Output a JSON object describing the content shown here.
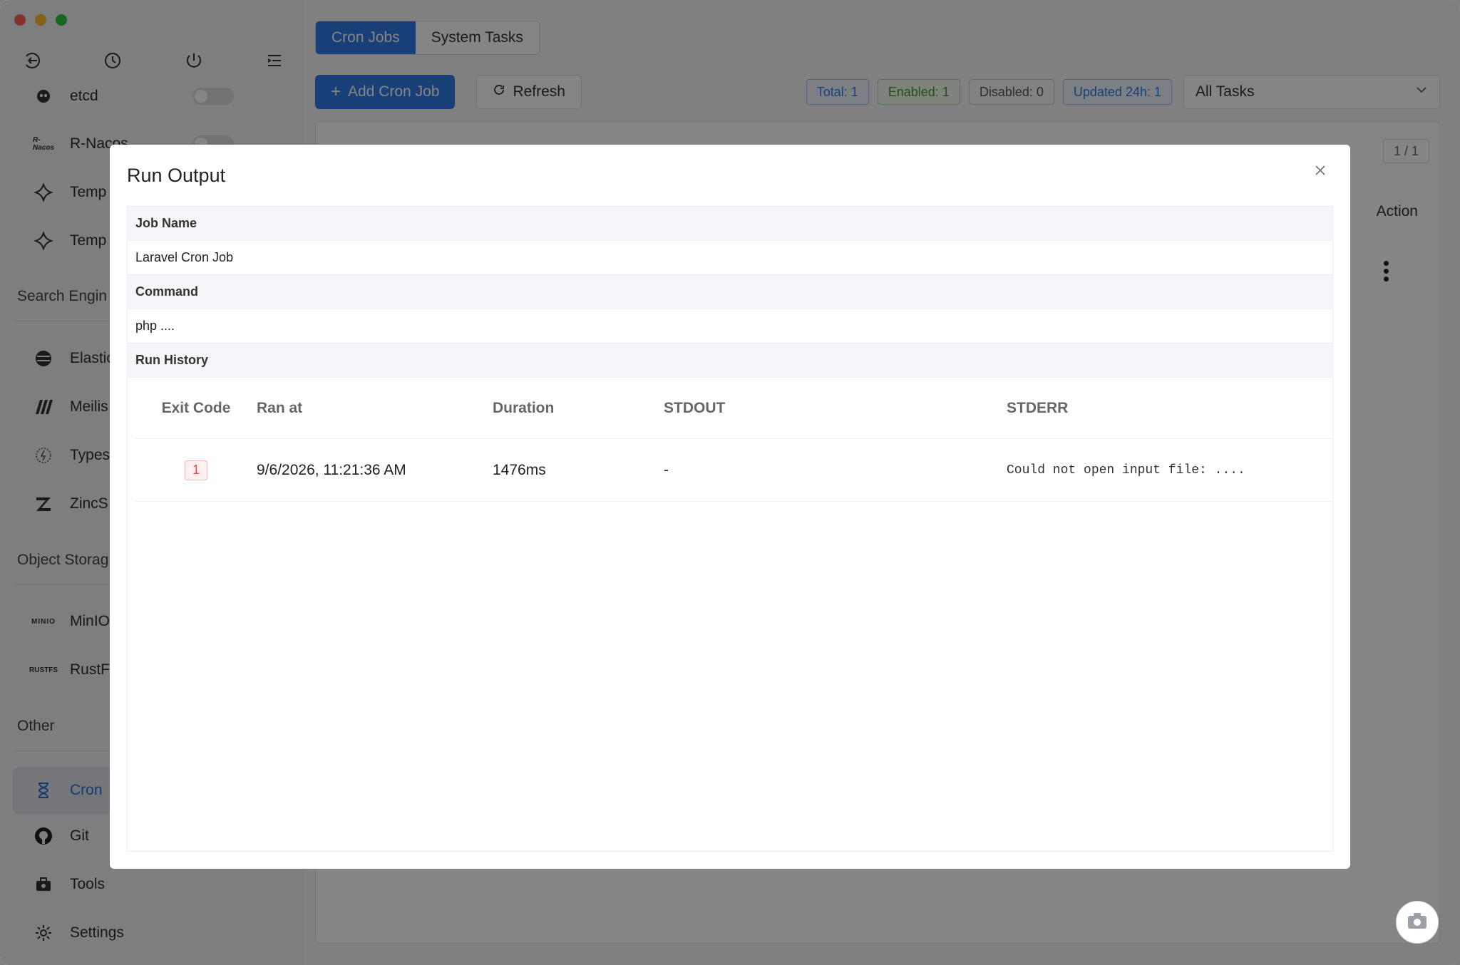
{
  "sidebar": {
    "items_top": [
      {
        "label": "etcd",
        "icon": "etcd-icon",
        "toggle": true
      },
      {
        "label": "R-Nacos",
        "icon": "r-nacos-icon",
        "toggle": true,
        "icon_text": "R-Nacos"
      },
      {
        "label": "Temp",
        "icon": "temporal-icon"
      },
      {
        "label": "Temp",
        "icon": "temporal-icon"
      }
    ],
    "section_search": "Search Engin",
    "items_search": [
      {
        "label": "Elastic",
        "icon": "elasticsearch-icon"
      },
      {
        "label": "Meilis",
        "icon": "meilisearch-icon"
      },
      {
        "label": "Types",
        "icon": "typesense-icon"
      },
      {
        "label": "ZincS",
        "icon": "zincsearch-icon"
      }
    ],
    "section_storage": "Object Storag",
    "items_storage": [
      {
        "label": "MinIO",
        "icon": "minio-icon",
        "icon_text": "MINIO"
      },
      {
        "label": "RustF",
        "icon": "rustfs-icon",
        "icon_text": "RUSTFS"
      }
    ],
    "section_other": "Other",
    "items_other": [
      {
        "label": "Cron",
        "icon": "hourglass-icon",
        "active": true
      },
      {
        "label": "Git",
        "icon": "github-icon"
      },
      {
        "label": "Tools",
        "icon": "toolbox-icon"
      },
      {
        "label": "Settings",
        "icon": "gear-icon"
      }
    ]
  },
  "main": {
    "tabs": [
      {
        "label": "Cron Jobs",
        "active": true
      },
      {
        "label": "System Tasks",
        "active": false
      }
    ],
    "add_button": "Add Cron Job",
    "refresh_button": "Refresh",
    "stats": {
      "total": "Total: 1",
      "enabled": "Enabled: 1",
      "disabled": "Disabled: 0",
      "updated": "Updated 24h: 1"
    },
    "filter_select": "All Tasks",
    "pager": "1 / 1",
    "col_action": "Action"
  },
  "modal": {
    "title": "Run Output",
    "job_name_label": "Job Name",
    "job_name_value": "Laravel Cron Job",
    "command_label": "Command",
    "command_value": "php ....",
    "history_label": "Run History",
    "history_columns": [
      "Exit Code",
      "Ran at",
      "Duration",
      "STDOUT",
      "STDERR"
    ],
    "history_rows": [
      {
        "exit_code": "1",
        "ran_at": "9/6/2026, 11:21:36 AM",
        "duration": "1476ms",
        "stdout": "-",
        "stderr": "Could not open input file: ...."
      }
    ]
  },
  "colors": {
    "accent": "#2f7ae5",
    "error": "#e5484d",
    "success": "#3f9b2f"
  }
}
